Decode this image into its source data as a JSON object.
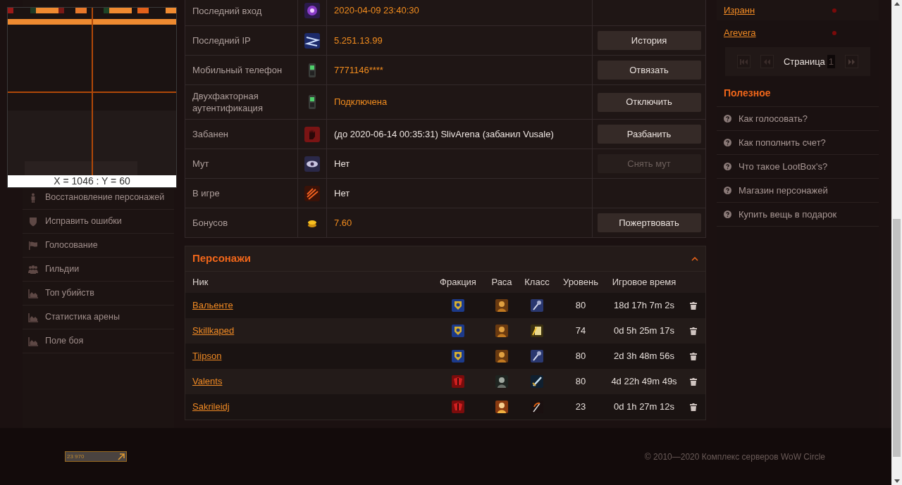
{
  "sidebar": {
    "items": [
      {
        "label": "Восстановление персонажей",
        "kind": "person"
      },
      {
        "label": "Исправить ошибки",
        "kind": "shield"
      },
      {
        "label": "Голосование",
        "kind": "flag"
      },
      {
        "label": "Гильдии",
        "kind": "group"
      },
      {
        "label": "Топ убийств",
        "kind": "chart"
      },
      {
        "label": "Статистика арены",
        "kind": "chart"
      },
      {
        "label": "Поле боя",
        "kind": "chart"
      }
    ]
  },
  "magnifier": {
    "readout": "X = 1046 : Y = 60"
  },
  "account_info": {
    "rows": [
      {
        "label": "Последний вход",
        "kind": "orb",
        "value": "2020-04-09 23:40:30",
        "accent": true
      },
      {
        "label": "Последний IP",
        "kind": "network",
        "value": "5.251.13.99",
        "accent": true,
        "action": {
          "label": "История",
          "disabled": false
        }
      },
      {
        "label": "Мобильный телефон",
        "kind": "phone",
        "value": "7771146****",
        "accent": true,
        "action": {
          "label": "Отвязать",
          "disabled": false
        }
      },
      {
        "label": "Двухфакторная аутентификация",
        "kind": "phone",
        "value": "Подключена",
        "accent": true,
        "action": {
          "label": "Отключить",
          "disabled": false
        }
      },
      {
        "label": "Забанен",
        "kind": "hand",
        "value": "(до 2020-06-14 00:35:31) SlivArena (забанил Vusale)",
        "accent": false,
        "action": {
          "label": "Разбанить",
          "disabled": false
        }
      },
      {
        "label": "Мут",
        "kind": "eye",
        "value": "Нет",
        "accent": false,
        "action": {
          "label": "Снять мут",
          "disabled": true
        }
      },
      {
        "label": "В игре",
        "kind": "slash",
        "value": "Нет",
        "accent": false
      },
      {
        "label": "Бонусов",
        "kind": "coins",
        "value": "7.60",
        "accent": true,
        "action": {
          "label": "Пожертвовать",
          "disabled": false
        }
      }
    ]
  },
  "characters": {
    "title": "Персонажи",
    "expanded": true,
    "columns": [
      "Ник",
      "Фракция",
      "Раса",
      "Класс",
      "Уровень",
      "Игровое время"
    ],
    "rows": [
      {
        "nick": "Вальенте",
        "icons": [
          {
            "kind": "alliance"
          },
          {
            "kind": "golden"
          },
          {
            "kind": "mace"
          }
        ],
        "level": "80",
        "time": "18d 17h 7m 2s"
      },
      {
        "nick": "Skillkaped",
        "icons": [
          {
            "kind": "alliance"
          },
          {
            "kind": "golden"
          },
          {
            "kind": "book"
          }
        ],
        "level": "74",
        "time": "0d 5h 25m 17s"
      },
      {
        "nick": "Tiipson",
        "icons": [
          {
            "kind": "alliance"
          },
          {
            "kind": "golden"
          },
          {
            "kind": "mace"
          }
        ],
        "level": "80",
        "time": "2d 3h 48m 56s"
      },
      {
        "nick": "Valents",
        "icons": [
          {
            "kind": "horde"
          },
          {
            "kind": "pale"
          },
          {
            "kind": "sword"
          }
        ],
        "level": "80",
        "time": "4d 22h 49m 49s"
      },
      {
        "nick": "Sakrileidj",
        "icons": [
          {
            "kind": "horde"
          },
          {
            "kind": "fair"
          },
          {
            "kind": "scythe"
          }
        ],
        "level": "23",
        "time": "0d 1h 27m 12s"
      }
    ]
  },
  "friends": [
    {
      "name": "Изранн",
      "online": false
    },
    {
      "name": "Arevera",
      "online": false
    }
  ],
  "pagination": {
    "label": "Страница",
    "page": "1"
  },
  "useful": {
    "title": "Полезное",
    "items": [
      "Как голосовать?",
      "Как пополнить счет?",
      "Что такое LootBox's?",
      "Магазин персонажей",
      "Купить вещь в подарок"
    ]
  },
  "footer": {
    "counter": "23 970",
    "copyright": "© 2010—2020 Комплекс серверов WoW Circle"
  }
}
